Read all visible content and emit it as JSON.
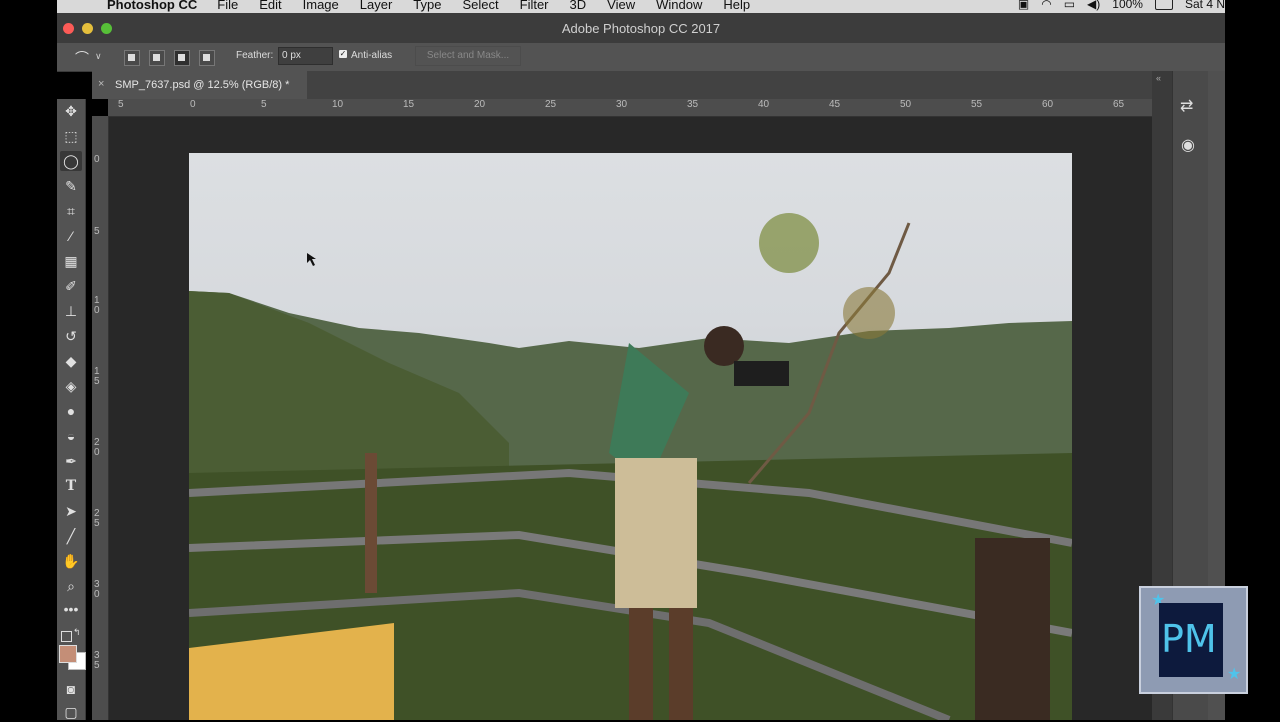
{
  "menubar": {
    "app_name": "Photoshop CC",
    "menus": [
      "File",
      "Edit",
      "Image",
      "Layer",
      "Type",
      "Select",
      "Filter",
      "3D",
      "View",
      "Window",
      "Help"
    ],
    "battery": "100%",
    "clock": "Sat 4 N"
  },
  "window": {
    "title": "Adobe Photoshop CC 2017"
  },
  "options_bar": {
    "feather_label": "Feather:",
    "feather_value": "0 px",
    "antialias_label": "Anti-alias",
    "antialias_checked": true,
    "select_mask_label": "Select and Mask..."
  },
  "document_tab": {
    "label": "SMP_7637.psd @ 12.5% (RGB/8) *"
  },
  "ruler_top": [
    "5",
    "0",
    "5",
    "10",
    "15",
    "20",
    "25",
    "30",
    "35",
    "40",
    "45",
    "50",
    "55",
    "60",
    "65"
  ],
  "ruler_left": [
    "0",
    "5",
    "1 0",
    "1 5",
    "2 0",
    "2 5",
    "3 0",
    "3 5"
  ],
  "toolbar": {
    "tools": [
      "move",
      "marquee",
      "lasso",
      "quick-select",
      "crop",
      "eyedropper",
      "healing",
      "brush",
      "clone-stamp",
      "history-brush",
      "eraser",
      "gradient",
      "blur",
      "dodge",
      "pen",
      "type",
      "path-select",
      "line",
      "hand",
      "zoom",
      "more"
    ],
    "active_tool": "lasso",
    "foreground_color": "#c48e77",
    "background_color": "#ffffff"
  },
  "logo": {
    "text": "PM"
  }
}
